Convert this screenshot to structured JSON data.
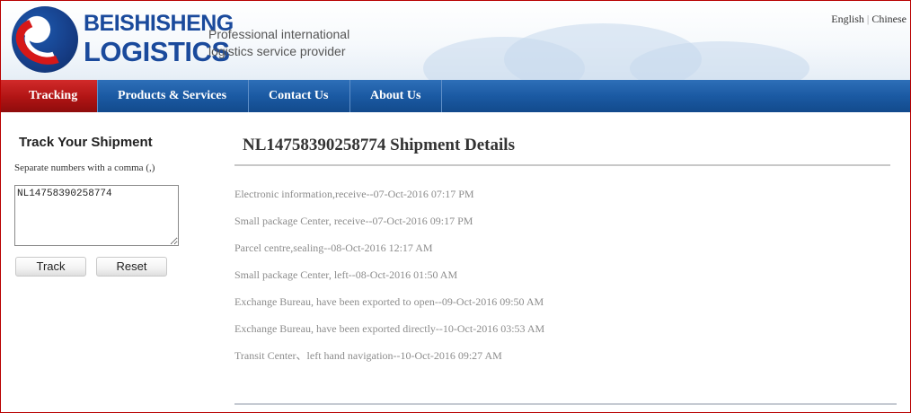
{
  "header": {
    "brand_line1": "BEISHISHENG",
    "brand_line2": "LOGISTICS",
    "tagline_line1": "Professional international",
    "tagline_line2": "logistics service provider",
    "lang_english": "English",
    "lang_separator": "|",
    "lang_chinese": "Chinese"
  },
  "nav": {
    "items": [
      {
        "label": "Tracking",
        "active": true
      },
      {
        "label": "Products & Services",
        "active": false
      },
      {
        "label": "Contact Us",
        "active": false
      },
      {
        "label": "About Us",
        "active": false
      }
    ]
  },
  "sidebar": {
    "title": "Track Your Shipment",
    "hint": "Separate numbers with a comma (,)",
    "input_value": "NL14758390258774",
    "track_button": "Track",
    "reset_button": "Reset"
  },
  "main": {
    "title": "NL14758390258774 Shipment Details",
    "events": [
      "Electronic information,receive--07-Oct-2016 07:17 PM",
      "Small package Center, receive--07-Oct-2016 09:17 PM",
      "Parcel centre,sealing--08-Oct-2016 12:17 AM",
      "Small package Center, left--08-Oct-2016 01:50 AM",
      "Exchange Bureau, have been exported to open--09-Oct-2016 09:50 AM",
      "Exchange Bureau, have been exported directly--10-Oct-2016 03:53 AM",
      "Transit Center、left hand navigation--10-Oct-2016 09:27 AM"
    ]
  },
  "colors": {
    "nav_blue": "#1b5aa3",
    "nav_active_red": "#b01414",
    "brand_blue": "#1a4a9c",
    "event_text": "#8c8c8c"
  }
}
